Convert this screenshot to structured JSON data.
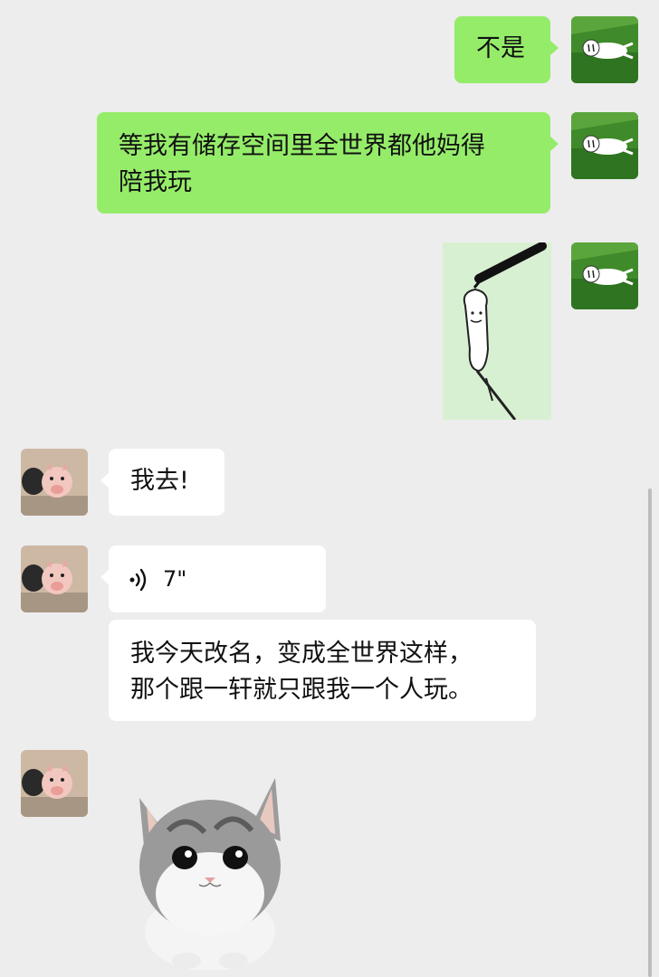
{
  "messages": {
    "m1_text": "不是",
    "m2_line1": "等我有储存空间里全世界都他妈得",
    "m2_line2": "陪我玩",
    "m3_sticker": "sketch-character-sticker",
    "m4_text": "我去!",
    "m5_voice_duration": "7\"",
    "m6_line1": "我今天改名，变成全世界这样，",
    "m6_line2": "那个跟一轩就只跟我一个人玩。",
    "m7_sticker": "cat-sticker"
  },
  "colors": {
    "background": "#ededed",
    "outgoing_bubble": "#95ec69",
    "incoming_bubble": "#ffffff"
  },
  "icons": {
    "voice": "voice-wave-icon",
    "self_avatar": "grass-cartoon-avatar",
    "peer_avatar": "piglets-avatar"
  }
}
